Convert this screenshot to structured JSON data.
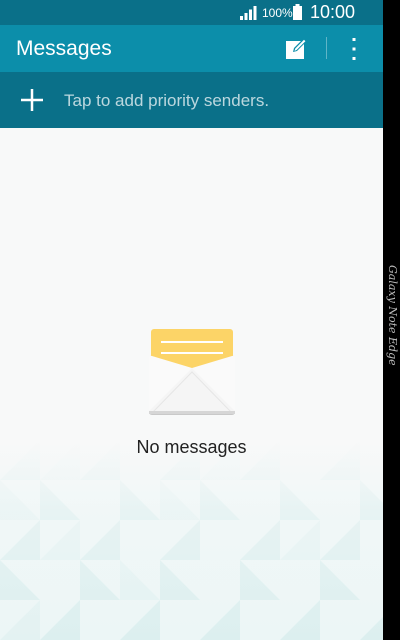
{
  "status_bar": {
    "battery_percent": "100%",
    "time": "10:00",
    "signal_icon": "signal-bars-icon",
    "battery_icon": "battery-full-icon"
  },
  "action_bar": {
    "title": "Messages",
    "compose_icon": "compose-icon",
    "more_icon": "more-vert-icon"
  },
  "priority": {
    "add_icon": "plus-icon",
    "label": "Tap to add priority senders."
  },
  "empty_state": {
    "icon": "envelope-icon",
    "label": "No messages"
  },
  "edge_panel": {
    "text": "Galaxy Note Edge"
  },
  "colors": {
    "status_bar": "#0a7089",
    "action_bar": "#0c8eaa",
    "priority_row": "#0a7089",
    "envelope_letter": "#fcd467",
    "background": "#f8f9f9"
  }
}
